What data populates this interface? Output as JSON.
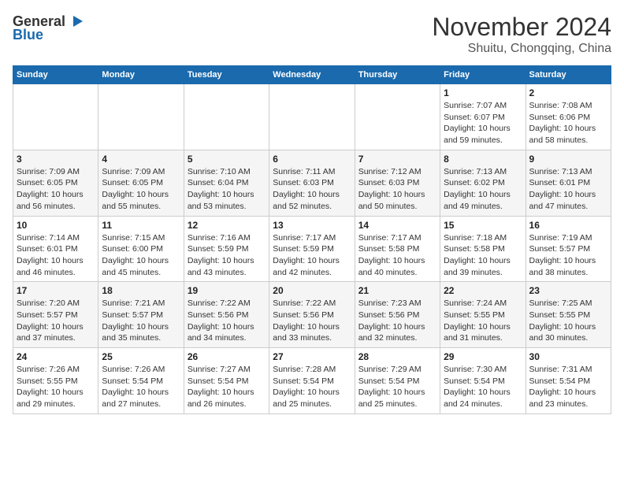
{
  "header": {
    "logo_line1": "General",
    "logo_line2": "Blue",
    "title": "November 2024",
    "subtitle": "Shuitu, Chongqing, China"
  },
  "calendar": {
    "days_of_week": [
      "Sunday",
      "Monday",
      "Tuesday",
      "Wednesday",
      "Thursday",
      "Friday",
      "Saturday"
    ],
    "weeks": [
      [
        {
          "day": "",
          "info": ""
        },
        {
          "day": "",
          "info": ""
        },
        {
          "day": "",
          "info": ""
        },
        {
          "day": "",
          "info": ""
        },
        {
          "day": "",
          "info": ""
        },
        {
          "day": "1",
          "info": "Sunrise: 7:07 AM\nSunset: 6:07 PM\nDaylight: 10 hours and 59 minutes."
        },
        {
          "day": "2",
          "info": "Sunrise: 7:08 AM\nSunset: 6:06 PM\nDaylight: 10 hours and 58 minutes."
        }
      ],
      [
        {
          "day": "3",
          "info": "Sunrise: 7:09 AM\nSunset: 6:05 PM\nDaylight: 10 hours and 56 minutes."
        },
        {
          "day": "4",
          "info": "Sunrise: 7:09 AM\nSunset: 6:05 PM\nDaylight: 10 hours and 55 minutes."
        },
        {
          "day": "5",
          "info": "Sunrise: 7:10 AM\nSunset: 6:04 PM\nDaylight: 10 hours and 53 minutes."
        },
        {
          "day": "6",
          "info": "Sunrise: 7:11 AM\nSunset: 6:03 PM\nDaylight: 10 hours and 52 minutes."
        },
        {
          "day": "7",
          "info": "Sunrise: 7:12 AM\nSunset: 6:03 PM\nDaylight: 10 hours and 50 minutes."
        },
        {
          "day": "8",
          "info": "Sunrise: 7:13 AM\nSunset: 6:02 PM\nDaylight: 10 hours and 49 minutes."
        },
        {
          "day": "9",
          "info": "Sunrise: 7:13 AM\nSunset: 6:01 PM\nDaylight: 10 hours and 47 minutes."
        }
      ],
      [
        {
          "day": "10",
          "info": "Sunrise: 7:14 AM\nSunset: 6:01 PM\nDaylight: 10 hours and 46 minutes."
        },
        {
          "day": "11",
          "info": "Sunrise: 7:15 AM\nSunset: 6:00 PM\nDaylight: 10 hours and 45 minutes."
        },
        {
          "day": "12",
          "info": "Sunrise: 7:16 AM\nSunset: 5:59 PM\nDaylight: 10 hours and 43 minutes."
        },
        {
          "day": "13",
          "info": "Sunrise: 7:17 AM\nSunset: 5:59 PM\nDaylight: 10 hours and 42 minutes."
        },
        {
          "day": "14",
          "info": "Sunrise: 7:17 AM\nSunset: 5:58 PM\nDaylight: 10 hours and 40 minutes."
        },
        {
          "day": "15",
          "info": "Sunrise: 7:18 AM\nSunset: 5:58 PM\nDaylight: 10 hours and 39 minutes."
        },
        {
          "day": "16",
          "info": "Sunrise: 7:19 AM\nSunset: 5:57 PM\nDaylight: 10 hours and 38 minutes."
        }
      ],
      [
        {
          "day": "17",
          "info": "Sunrise: 7:20 AM\nSunset: 5:57 PM\nDaylight: 10 hours and 37 minutes."
        },
        {
          "day": "18",
          "info": "Sunrise: 7:21 AM\nSunset: 5:57 PM\nDaylight: 10 hours and 35 minutes."
        },
        {
          "day": "19",
          "info": "Sunrise: 7:22 AM\nSunset: 5:56 PM\nDaylight: 10 hours and 34 minutes."
        },
        {
          "day": "20",
          "info": "Sunrise: 7:22 AM\nSunset: 5:56 PM\nDaylight: 10 hours and 33 minutes."
        },
        {
          "day": "21",
          "info": "Sunrise: 7:23 AM\nSunset: 5:56 PM\nDaylight: 10 hours and 32 minutes."
        },
        {
          "day": "22",
          "info": "Sunrise: 7:24 AM\nSunset: 5:55 PM\nDaylight: 10 hours and 31 minutes."
        },
        {
          "day": "23",
          "info": "Sunrise: 7:25 AM\nSunset: 5:55 PM\nDaylight: 10 hours and 30 minutes."
        }
      ],
      [
        {
          "day": "24",
          "info": "Sunrise: 7:26 AM\nSunset: 5:55 PM\nDaylight: 10 hours and 29 minutes."
        },
        {
          "day": "25",
          "info": "Sunrise: 7:26 AM\nSunset: 5:54 PM\nDaylight: 10 hours and 27 minutes."
        },
        {
          "day": "26",
          "info": "Sunrise: 7:27 AM\nSunset: 5:54 PM\nDaylight: 10 hours and 26 minutes."
        },
        {
          "day": "27",
          "info": "Sunrise: 7:28 AM\nSunset: 5:54 PM\nDaylight: 10 hours and 25 minutes."
        },
        {
          "day": "28",
          "info": "Sunrise: 7:29 AM\nSunset: 5:54 PM\nDaylight: 10 hours and 25 minutes."
        },
        {
          "day": "29",
          "info": "Sunrise: 7:30 AM\nSunset: 5:54 PM\nDaylight: 10 hours and 24 minutes."
        },
        {
          "day": "30",
          "info": "Sunrise: 7:31 AM\nSunset: 5:54 PM\nDaylight: 10 hours and 23 minutes."
        }
      ]
    ]
  }
}
